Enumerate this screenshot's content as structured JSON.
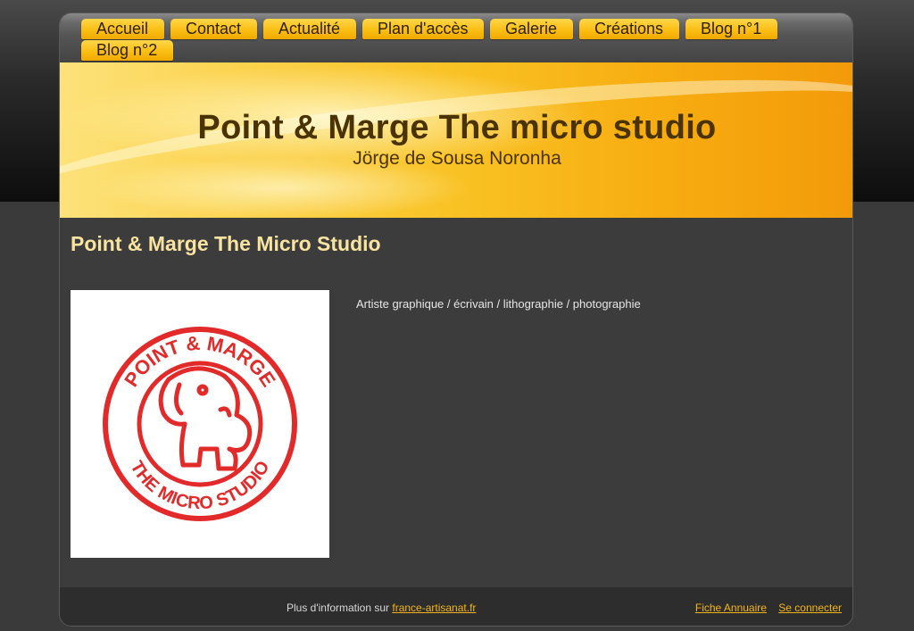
{
  "nav": {
    "items": [
      {
        "label": "Accueil"
      },
      {
        "label": "Contact"
      },
      {
        "label": "Actualité"
      },
      {
        "label": "Plan d'accès"
      },
      {
        "label": "Galerie"
      },
      {
        "label": "Créations"
      },
      {
        "label": "Blog n°1"
      },
      {
        "label": "Blog n°2"
      }
    ]
  },
  "header": {
    "title": "Point & Marge The micro studio",
    "subtitle": "Jörge de Sousa Noronha"
  },
  "main": {
    "heading": "Point & Marge The Micro Studio",
    "description": "Artiste graphique / écrivain / lithographie / photographie",
    "logo": {
      "top_text": "POINT & MARGE",
      "bottom_text": "THE MICRO STUDIO",
      "color": "#e32a2a"
    }
  },
  "footer": {
    "info_prefix": "Plus d'information sur",
    "info_link": "france-artisanat.fr",
    "annuaire_link": "Fiche Annuaire",
    "login_link": "Se connecter"
  },
  "colors": {
    "accent": "#fbbf14",
    "heading": "#f8e4a0",
    "link": "#f3b51a",
    "stamp": "#e32a2a"
  }
}
